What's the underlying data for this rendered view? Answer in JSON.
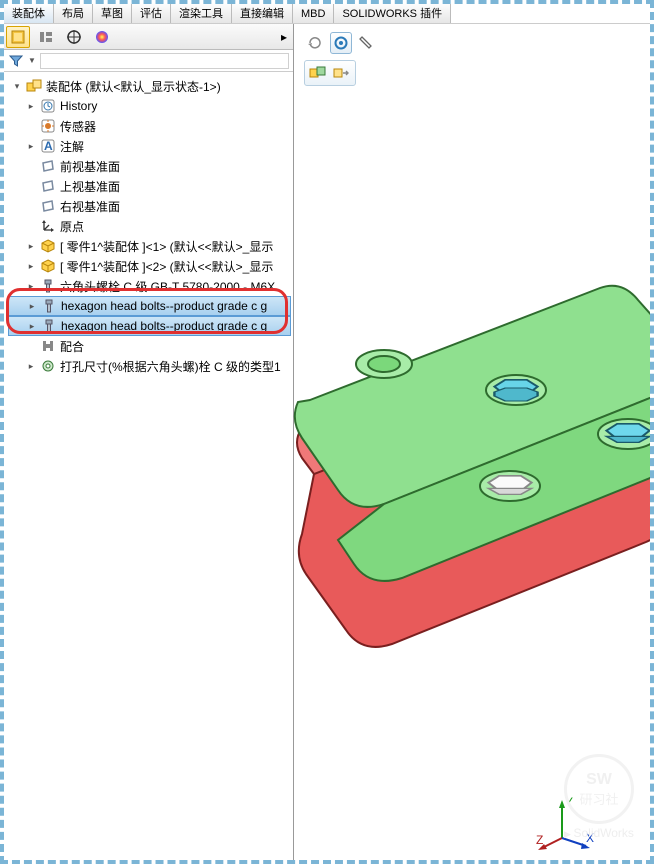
{
  "menu": {
    "items": [
      "装配体",
      "布局",
      "草图",
      "评估",
      "渲染工具",
      "直接编辑",
      "MBD",
      "SOLIDWORKS 插件"
    ],
    "active": 0
  },
  "tree": {
    "root": "装配体  (默认<默认_显示状态-1>)",
    "items": [
      {
        "icon": "history",
        "label": "History",
        "arrow": true
      },
      {
        "icon": "sensor",
        "label": "传感器"
      },
      {
        "icon": "annotation",
        "label": "注解",
        "arrow": true
      },
      {
        "icon": "plane",
        "label": "前视基准面"
      },
      {
        "icon": "plane",
        "label": "上视基准面"
      },
      {
        "icon": "plane",
        "label": "右视基准面"
      },
      {
        "icon": "origin",
        "label": "原点"
      },
      {
        "icon": "part",
        "label": "[ 零件1^装配体 ]<1> (默认<<默认>_显示",
        "arrow": true
      },
      {
        "icon": "part",
        "label": "[ 零件1^装配体 ]<2> (默认<<默认>_显示",
        "arrow": true
      },
      {
        "icon": "bolt",
        "label": "六角头螺栓 C 级 GB-T 5780-2000 - M6X",
        "arrow": true
      },
      {
        "icon": "bolt",
        "label": "hexagon head bolts--product grade c g",
        "arrow": true,
        "sel": true
      },
      {
        "icon": "bolt",
        "label": "hexagon head bolts--product grade c g",
        "arrow": true,
        "sel": true
      },
      {
        "icon": "mate",
        "label": "配合"
      },
      {
        "icon": "hole",
        "label": "打孔尺寸(%根据六角头螺)栓 C 级的类型1",
        "arrow": true
      }
    ]
  },
  "watermark": {
    "top": "SW",
    "bottom": "研习社",
    "url": "SolidWorks"
  }
}
